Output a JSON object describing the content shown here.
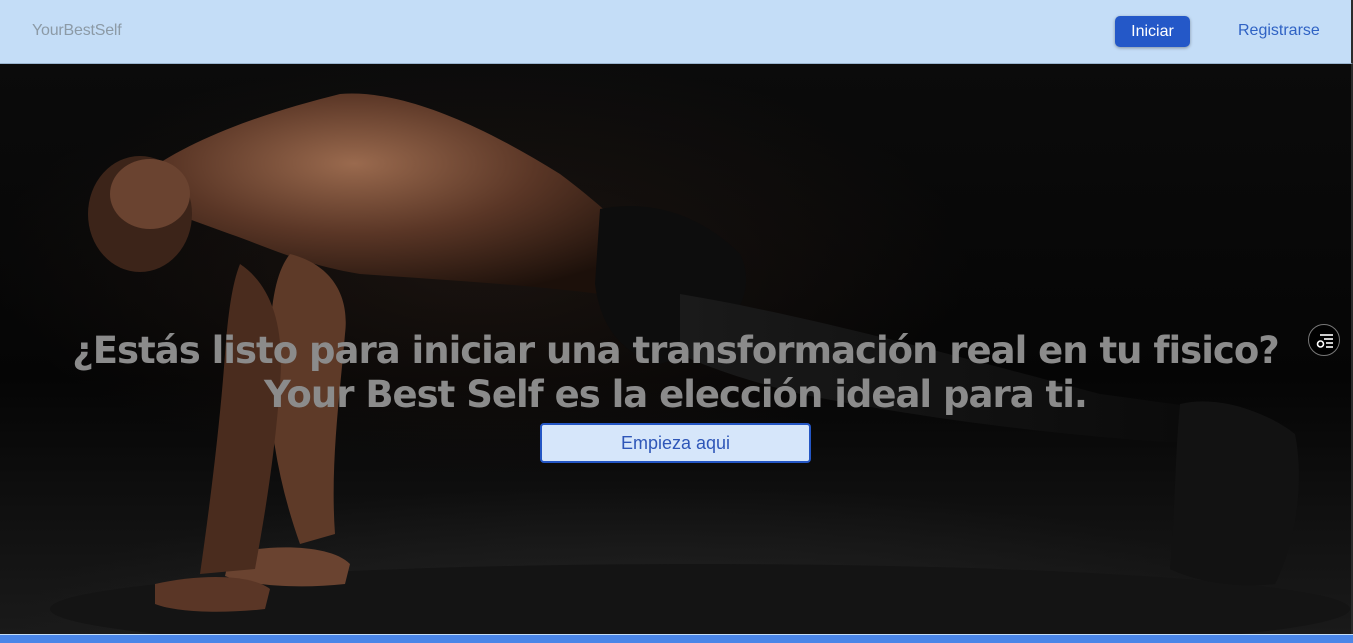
{
  "navbar": {
    "brand": "YourBestSelf",
    "login_label": "Iniciar",
    "register_label": "Registrarse"
  },
  "hero": {
    "title_line1": "¿Estás listo para iniciar una transformación real en tu fisico?",
    "title_line2": "Your Best Self es la elección ideal para ti.",
    "cta_label": "Empieza aqui",
    "background_image": "man-doing-pushup-plank-dark-background"
  },
  "side_tool": {
    "icon": "filter-settings-icon"
  },
  "colors": {
    "navbar_bg": "#c4ddf7",
    "primary": "#2458c8",
    "link": "#2f62c4",
    "hero_text": "#8b8b8b",
    "cta_bg": "#d6e6fa"
  }
}
